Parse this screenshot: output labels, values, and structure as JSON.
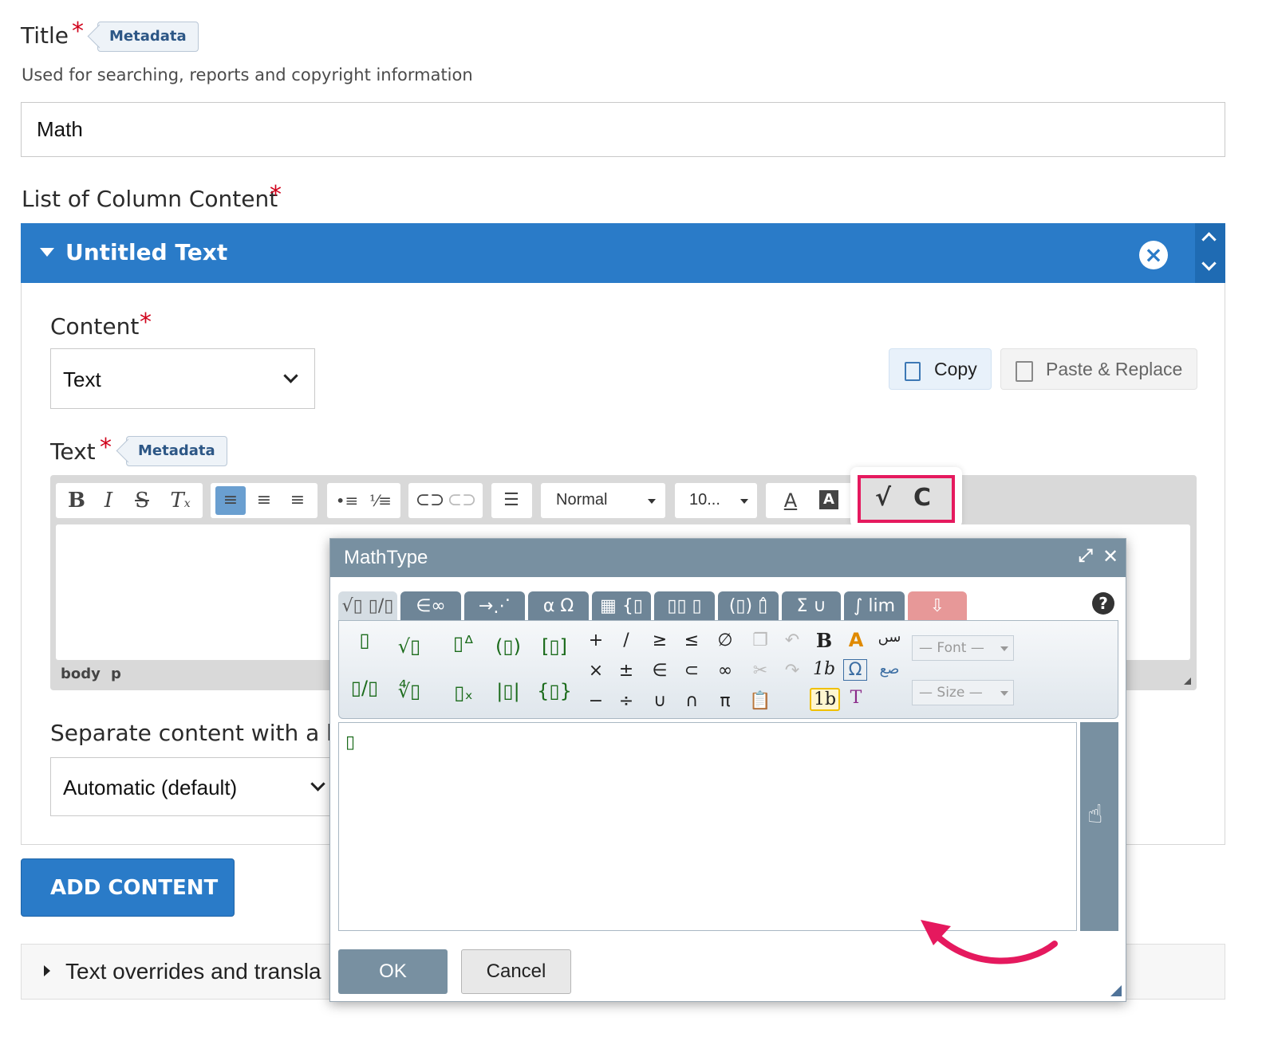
{
  "title_field": {
    "label": "Title",
    "badge": "Metadata",
    "description": "Used for searching, reports and copyright information",
    "value": "Math"
  },
  "column_list": {
    "label": "List of Column Content",
    "panel_title": "Untitled Text",
    "panel_color": "#2a7bc8"
  },
  "content_field": {
    "label": "Content",
    "selected": "Text",
    "copy_label": "Copy",
    "paste_label": "Paste & Replace"
  },
  "text_field": {
    "label": "Text",
    "badge": "Metadata"
  },
  "editor": {
    "format_select": "Normal",
    "size_select": "10...",
    "path_body": "body",
    "path_p": "p",
    "mathtype_icon": "√",
    "chemtype_icon": "C"
  },
  "separator_field": {
    "label": "Separate content with a ho",
    "selected": "Automatic (default)"
  },
  "add_content_label": "ADD CONTENT",
  "overrides_label": "Text overrides and transla",
  "mathtype": {
    "title": "MathType",
    "tabs": [
      "√▯ ▯/▯",
      "∈∞",
      "→⋰",
      "α Ω",
      "▦ {▯",
      "▯▯ ▯",
      "(▯) ▯̂",
      "Σ ∪",
      "∫ lim",
      "⇩"
    ],
    "help": "?",
    "ops_row1": [
      "+",
      "/",
      "≥",
      "≤",
      "∅"
    ],
    "ops_row2": [
      "×",
      "±",
      "∈",
      "⊂",
      "∞"
    ],
    "ops_row3": [
      "−",
      "÷",
      "∪",
      "∩",
      "π"
    ],
    "font_select": "— Font —",
    "size_select": "— Size —",
    "bold": "B",
    "italic_num": "1b",
    "text_mode": "T",
    "cursor_placeholder": "▯",
    "ok_label": "OK",
    "cancel_label": "Cancel"
  },
  "highlight_color": "#e5195e"
}
